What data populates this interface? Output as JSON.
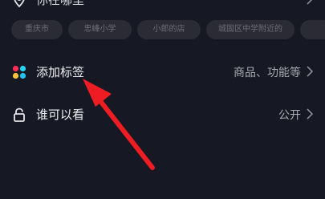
{
  "location_row": {
    "label": "你在哪里",
    "icon": "location-pin-icon"
  },
  "location_suggestions": [
    "重庆市",
    "忠峰小学",
    "小郎的店",
    "城固区中学附近的"
  ],
  "tags_row": {
    "label": "添加标签",
    "value": "商品、功能等",
    "icon": "tag-dots-icon"
  },
  "visibility_row": {
    "label": "谁可以看",
    "value": "公开",
    "icon": "lock-icon"
  },
  "colors": {
    "background": "#161823",
    "annotation_arrow": "#ee1d23",
    "chip_background": "#2a2b35",
    "dot_red": "#fe2c55",
    "dot_yellow": "#f8c43a",
    "dot_blue": "#25d4f5",
    "dot_cyan": "#20c4ef"
  }
}
